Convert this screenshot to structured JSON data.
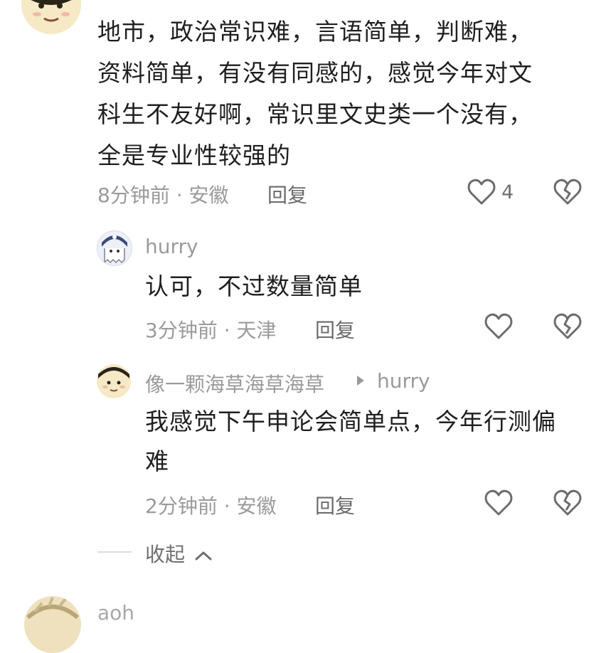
{
  "comment": {
    "text_lines": [
      "地市，政治常识难，言语简单，判断难，",
      "资料简单，有没有同感的，感觉今年对文",
      "科生不友好啊，常识里文史类一个没有，",
      "全是专业性较强的"
    ],
    "meta": "8分钟前 · 安徽",
    "reply_label": "回复",
    "like_count": "4",
    "like_icon": "heart-outline-icon",
    "dislike_icon": "broken-heart-icon"
  },
  "replies": [
    {
      "username": "hurry",
      "text_lines": [
        "认可，不过数量简单"
      ],
      "meta": "3分钟前 · 天津",
      "reply_label": "回复"
    },
    {
      "username": "像一颗海草海草海草",
      "reply_to": "hurry",
      "text_lines": [
        "我感觉下午申论会简单点，今年行测偏",
        "难"
      ],
      "meta": "2分钟前 · 安徽",
      "reply_label": "回复"
    }
  ],
  "collapse_label": "收起",
  "next_comment": {
    "username_partial": "aoh"
  }
}
